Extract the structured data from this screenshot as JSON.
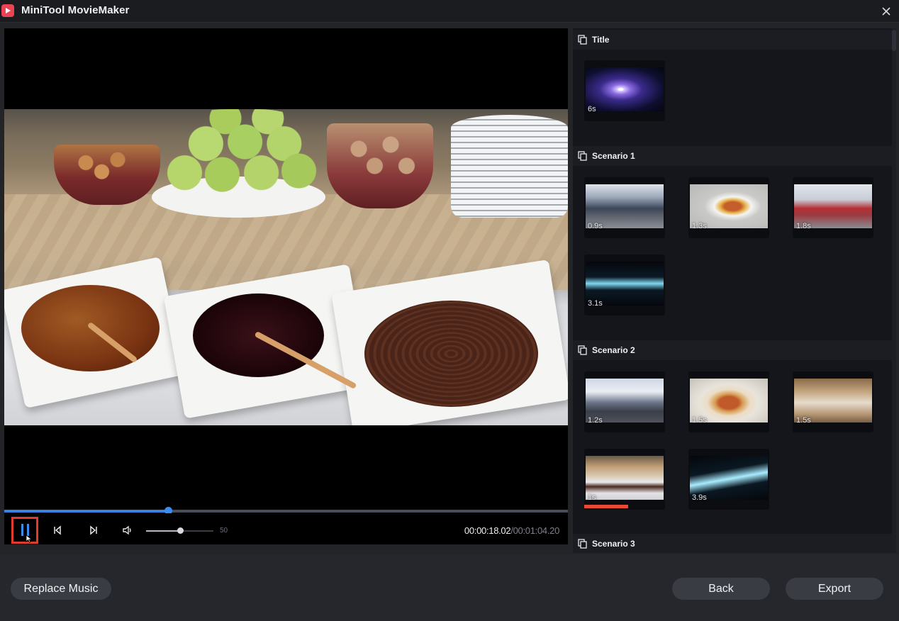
{
  "window": {
    "title": "MiniTool MovieMaker",
    "logo_icon": "play-logo-icon",
    "close_icon": "close-icon"
  },
  "player": {
    "playback_progress": 0.29,
    "volume_level": 0.5,
    "volume_value": "50",
    "current_time": "00:00:18.02",
    "total_time": "/00:01:04.20",
    "accent_color": "#3b82e0",
    "highlight_color": "#e13b2e"
  },
  "sections": [
    {
      "label": "Title",
      "clips": [
        {
          "duration": "6s",
          "thumb": "galaxy"
        }
      ]
    },
    {
      "label": "Scenario 1",
      "clips": [
        {
          "duration": "0.9s",
          "thumb": "crowd"
        },
        {
          "duration": "1.3s",
          "thumb": "plate"
        },
        {
          "duration": "1.8s",
          "thumb": "hall"
        },
        {
          "duration": "3.1s",
          "thumb": "light-streak"
        }
      ]
    },
    {
      "label": "Scenario 2",
      "clips": [
        {
          "duration": "1.2s",
          "thumb": "airport"
        },
        {
          "duration": "1.5s",
          "thumb": "plate"
        },
        {
          "duration": "1.5s",
          "thumb": "buffet"
        },
        {
          "duration": "1s",
          "thumb": "dishes",
          "selected": true
        },
        {
          "duration": "3.9s",
          "thumb": "light-streak"
        }
      ]
    },
    {
      "label": "Scenario 3",
      "clips": []
    }
  ],
  "footer": {
    "replace_music": "Replace Music",
    "back": "Back",
    "export": "Export"
  }
}
